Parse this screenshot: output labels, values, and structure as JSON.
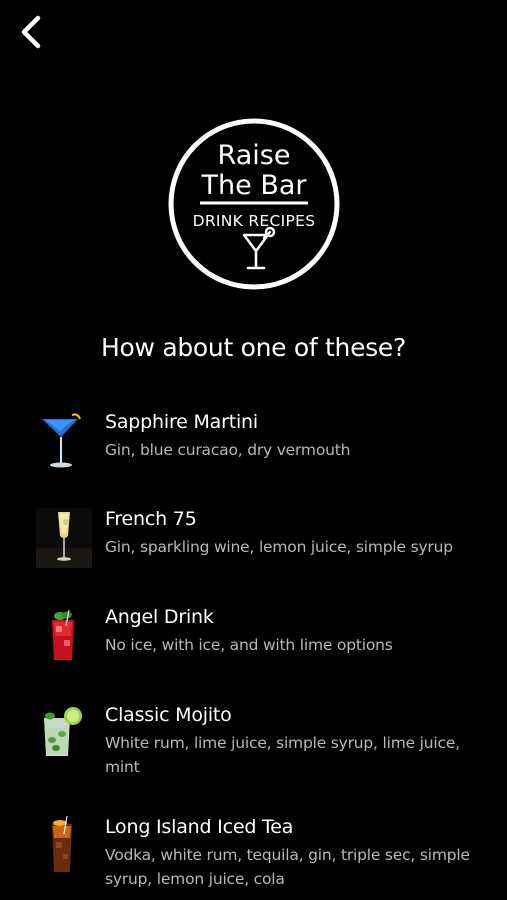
{
  "nav": {
    "back_icon": "chevron-left-icon"
  },
  "logo": {
    "line1": "Raise",
    "line2": "The Bar",
    "line3": "DRINK RECIPES",
    "icon": "martini-glass-icon"
  },
  "heading": "How about one of these?",
  "drinks": [
    {
      "name": "Sapphire Martini",
      "ingredients": "Gin, blue curacao, dry vermouth",
      "thumbnail": "blue-martini-photo"
    },
    {
      "name": "French 75",
      "ingredients": "Gin, sparkling wine, lemon juice, simple syrup",
      "thumbnail": "champagne-flute-photo"
    },
    {
      "name": "Angel Drink",
      "ingredients": "No ice, with ice, and with lime options",
      "thumbnail": "red-cocktail-photo"
    },
    {
      "name": "Classic Mojito",
      "ingredients": "White rum, lime juice, simple syrup, lime juice, mint",
      "thumbnail": "mojito-glass-photo"
    },
    {
      "name": "Long Island Iced Tea",
      "ingredients": "Vodka, white rum, tequila, gin, triple sec, simple syrup, lemon juice, cola",
      "thumbnail": "iced-tea-glass-photo"
    }
  ]
}
